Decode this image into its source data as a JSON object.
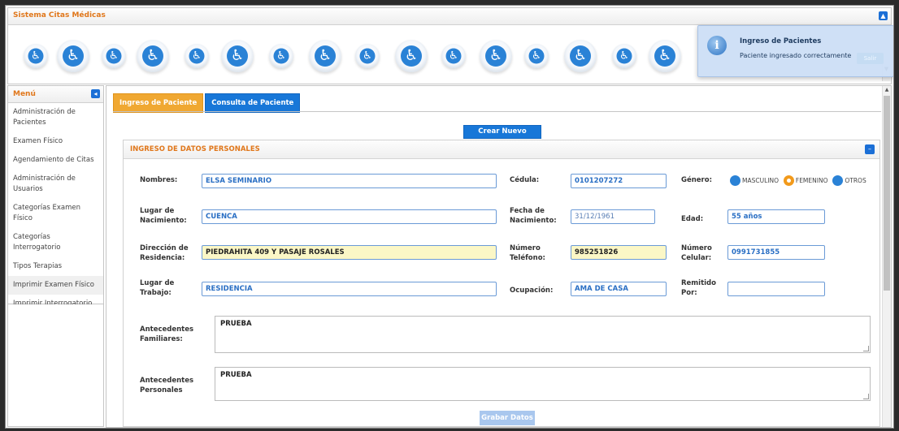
{
  "header": {
    "app_title": "Sistema Citas Médicas"
  },
  "menu": {
    "title": "Menú",
    "items": [
      {
        "label": "Administración de Pacientes"
      },
      {
        "label": "Examen Físico"
      },
      {
        "label": "Agendamiento de Citas"
      },
      {
        "label": "Administración de Usuarios"
      },
      {
        "label": "Categorías Examen Físico"
      },
      {
        "label": "Categorías Interrogatorio"
      },
      {
        "label": "Tipos Terapias"
      },
      {
        "label": "Imprimir Examen Físico"
      },
      {
        "label": "Imprimir Interrogatorio"
      }
    ]
  },
  "tabs": [
    {
      "label": "Ingreso de Paciente",
      "active": true
    },
    {
      "label": "Consulta de Paciente",
      "active": false
    }
  ],
  "actions": {
    "new_patient": "Crear Nuevo Paciente",
    "save": "Grabar Datos"
  },
  "section": {
    "title": "INGRESO DE DATOS PERSONALES"
  },
  "form": {
    "nombres": {
      "label": "Nombres:",
      "value": "ELSA SEMINARIO"
    },
    "cedula": {
      "label": "Cédula:",
      "value": "0101207272"
    },
    "genero": {
      "label": "Género:",
      "options": [
        "MASCULINO",
        "FEMENINO",
        "OTROS"
      ],
      "selected": "FEMENINO"
    },
    "lugar_nacimiento": {
      "label": "Lugar de Nacimiento:",
      "value": "CUENCA"
    },
    "fecha_nacimiento": {
      "label": "Fecha de Nacimiento:",
      "value": "31/12/1961"
    },
    "edad": {
      "label": "Edad:",
      "value": "55 años"
    },
    "direccion": {
      "label": "Dirección de Residencia:",
      "value": "PIEDRAHITA 409 Y PASAJE ROSALES"
    },
    "telefono": {
      "label": "Número Teléfono:",
      "value": "985251826"
    },
    "celular": {
      "label": "Número Celular:",
      "value": "0991731855"
    },
    "lugar_trabajo": {
      "label": "Lugar de Trabajo:",
      "value": "RESIDENCIA"
    },
    "ocupacion": {
      "label": "Ocupación:",
      "value": "AMA DE CASA"
    },
    "remitido": {
      "label": "Remitido Por:",
      "value": ""
    },
    "antecedentes_familiares": {
      "label": "Antecedentes Familiares:",
      "value": "PRUEBA"
    },
    "antecedentes_personales": {
      "label": "Antecedentes Personales",
      "value": "PRUEBA"
    }
  },
  "notification": {
    "title": "Ingreso de Pacientes",
    "message": "Paciente ingresado correctamente",
    "button": "Salir"
  },
  "colors": {
    "accent_orange": "#f0a832",
    "primary_blue": "#1877d8",
    "title_orange": "#e0771b"
  }
}
